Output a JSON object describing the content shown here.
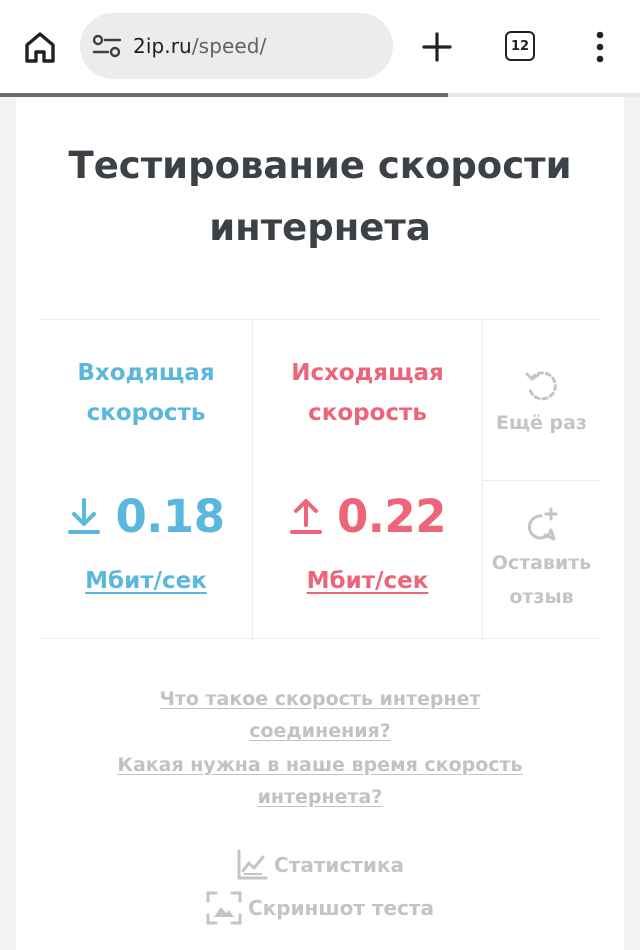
{
  "browser": {
    "url_host": "2ip.ru",
    "url_path": "/speed/",
    "tab_count": "12",
    "load_progress": 0.7
  },
  "page": {
    "title_line1": "Тестирование скорости",
    "title_line2": "интернета"
  },
  "download": {
    "label_line1": "Входящая",
    "label_line2": "скорость",
    "value": "0.18",
    "unit": "Мбит/сек",
    "color": "#5ab8df"
  },
  "upload": {
    "label_line1": "Исходящая",
    "label_line2": "скорость",
    "value": "0.22",
    "unit": "Мбит/сек",
    "color": "#ec6578"
  },
  "actions": {
    "retry_label": "Ещё раз",
    "feedback_line1": "Оставить",
    "feedback_line2": "отзыв"
  },
  "links": {
    "what_is_line1": "Что такое скорость интернет",
    "what_is_line2": "соединения?",
    "which_needed_line1": "Какая нужна в наше время скорость",
    "which_needed_line2": "интернета?",
    "statistics": "Статистика",
    "screenshot": "Скриншот теста"
  },
  "icons": [
    "home-icon",
    "site-settings-icon",
    "plus-icon",
    "tabs-icon",
    "more-vert-icon",
    "download-icon",
    "upload-icon",
    "refresh-icon",
    "comment-plus-icon",
    "chart-icon",
    "screenshot-icon"
  ]
}
